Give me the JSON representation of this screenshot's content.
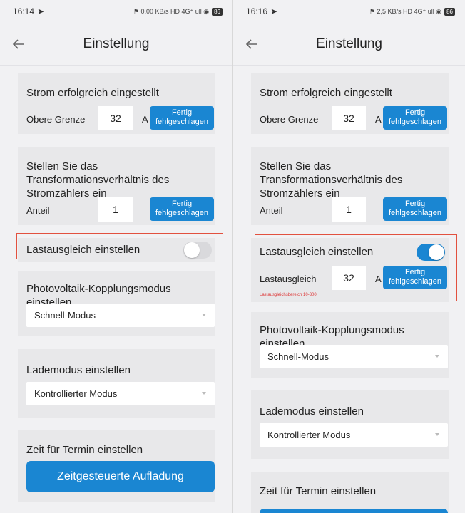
{
  "colors": {
    "accent": "#1a86d2",
    "highlight": "#e2513f",
    "background": "#f1f1f3",
    "card": "#e8e8ea",
    "error": "#dd3333"
  },
  "left": {
    "status": {
      "time": "16:14",
      "icons": "⚑ 0,00 KB/s HD 4G⁺ ull ◉",
      "battery": "86"
    },
    "title": "Einstellung",
    "current": {
      "title": "Strom erfolgreich eingestellt",
      "label": "Obere Grenze",
      "value": "32",
      "unit": "A",
      "button": "Fertig fehlgeschlagen"
    },
    "ratio": {
      "title": "Stellen Sie das Transformationsverhältnis des Stromzählers ein",
      "label": "Anteil",
      "value": "1",
      "button": "Fertig fehlgeschlagen"
    },
    "balance": {
      "title": "Lastausgleich einstellen",
      "enabled": false
    },
    "pv": {
      "title": "Photovoltaik-Kopplungsmodus einstellen",
      "selected": "Schnell-Modus"
    },
    "charge": {
      "title": "Lademodus einstellen",
      "selected": "Kontrollierter Modus"
    },
    "schedule": {
      "title": "Zeit für Termin einstellen",
      "button": "Zeitgesteuerte Aufladung"
    }
  },
  "right": {
    "status": {
      "time": "16:16",
      "icons": "⚑ 2,5 KB/s HD 4G⁺ ull ◉",
      "battery": "86"
    },
    "title": "Einstellung",
    "current": {
      "title": "Strom erfolgreich eingestellt",
      "label": "Obere Grenze",
      "value": "32",
      "unit": "A",
      "button": "Fertig fehlgeschlagen"
    },
    "ratio": {
      "title": "Stellen Sie das Transformationsverhältnis des Stromzählers ein",
      "label": "Anteil",
      "value": "1",
      "button": "Fertig fehlgeschlagen"
    },
    "balance": {
      "title": "Lastausgleich einstellen",
      "enabled": true,
      "label": "Lastausgleich",
      "value": "32",
      "unit": "A",
      "button": "Fertig fehlgeschlagen",
      "hint": "Lastausgleichsbereich 10-300"
    },
    "pv": {
      "title": "Photovoltaik-Kopplungsmodus einstellen",
      "selected": "Schnell-Modus"
    },
    "charge": {
      "title": "Lademodus einstellen",
      "selected": "Kontrollierter Modus"
    },
    "schedule": {
      "title": "Zeit für Termin einstellen"
    }
  }
}
